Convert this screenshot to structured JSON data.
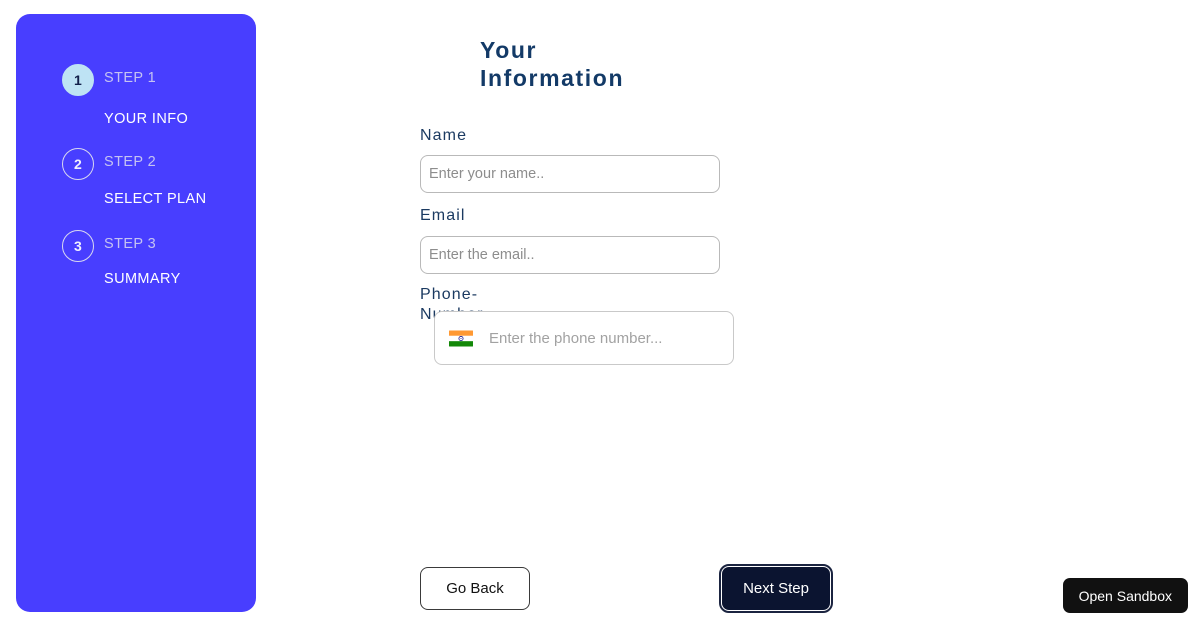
{
  "sidebar": {
    "background_color": "#483EFF",
    "steps": [
      {
        "number": "1",
        "step_label": "STEP 1",
        "title": "YOUR INFO",
        "active": true
      },
      {
        "number": "2",
        "step_label": "STEP 2",
        "title": "SELECT PLAN",
        "active": false
      },
      {
        "number": "3",
        "step_label": "STEP 3",
        "title": "SUMMARY",
        "active": false
      }
    ]
  },
  "form": {
    "heading": "Your Information",
    "heading_color": "#133A67",
    "fields": {
      "name": {
        "label": "Name",
        "value": "",
        "placeholder": "Enter your name.."
      },
      "email": {
        "label": "Email",
        "value": "",
        "placeholder": "Enter the email.."
      },
      "phone": {
        "label": "Phone-Number",
        "value": "",
        "placeholder": "Enter the phone number...",
        "flag_icon": "india-flag-icon"
      }
    }
  },
  "footer": {
    "go_back_label": "Go Back",
    "next_step_label": "Next Step"
  },
  "overlay": {
    "open_sandbox_label": "Open Sandbox"
  }
}
